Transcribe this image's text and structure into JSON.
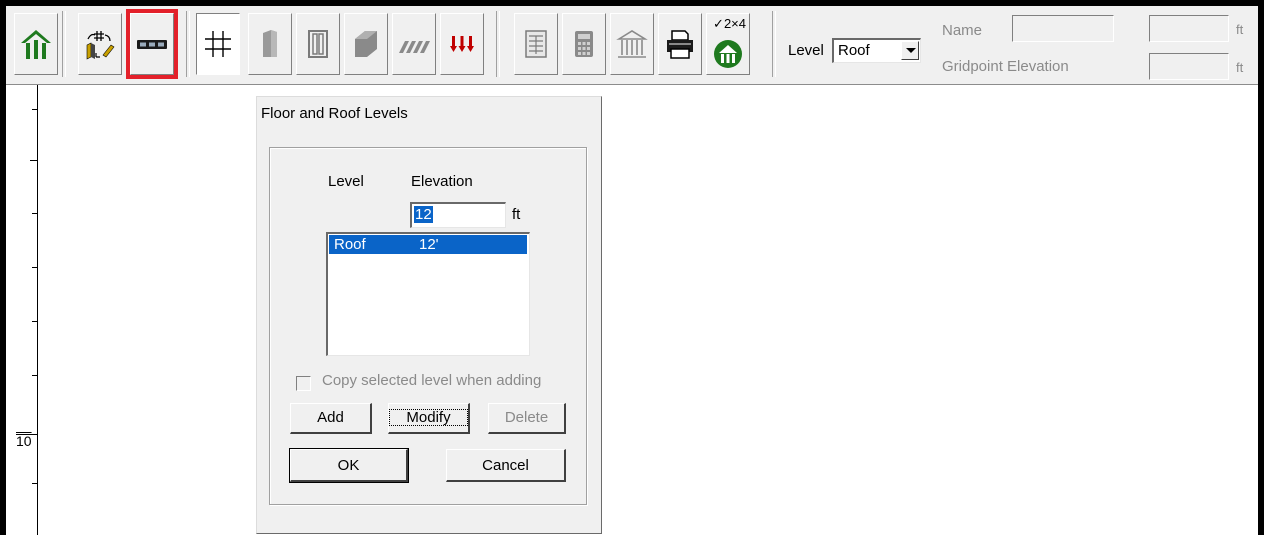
{
  "toolbar": {
    "buttons": [
      {
        "name": "home-building-icon"
      },
      {
        "name": "grid-layout-tool-icon"
      },
      {
        "name": "floor-roof-levels-icon",
        "highlighted": true,
        "highlight_color": "#e3202a"
      },
      {
        "name": "grid-icon",
        "pressed": true
      },
      {
        "name": "wall-panel-icon"
      },
      {
        "name": "column-icon"
      },
      {
        "name": "slab-icon"
      },
      {
        "name": "lateral-load-icon"
      },
      {
        "name": "gravity-load-icon"
      },
      {
        "name": "report-table-icon"
      },
      {
        "name": "calculator-icon"
      },
      {
        "name": "structure-icon"
      },
      {
        "name": "printer-icon"
      },
      {
        "name": "wood-2x4-icon",
        "badge": "✓2×4"
      }
    ],
    "level_label": "Level",
    "level_value": "Roof",
    "name_label": "Name",
    "gridpoint_elevation_label": "Gridpoint Elevation",
    "unit_ft": "ft"
  },
  "canvas": {
    "ruler_number": "10"
  },
  "dialog": {
    "title": "Floor and Roof Levels",
    "col_level": "Level",
    "col_elevation": "Elevation",
    "elevation_value": "12",
    "elevation_unit": "ft",
    "levels": [
      {
        "level": "Roof",
        "elevation": "12'",
        "selected": true
      }
    ],
    "copy_checkbox_label": "Copy selected level when adding",
    "copy_checked": false,
    "add_label": "Add",
    "modify_label": "Modify",
    "delete_label": "Delete",
    "ok_label": "OK",
    "cancel_label": "Cancel"
  },
  "colors": {
    "accent_green": "#1f7a1f",
    "selection_blue": "#0a64c8",
    "highlight_red": "#e3202a",
    "load_red": "#c00000"
  }
}
